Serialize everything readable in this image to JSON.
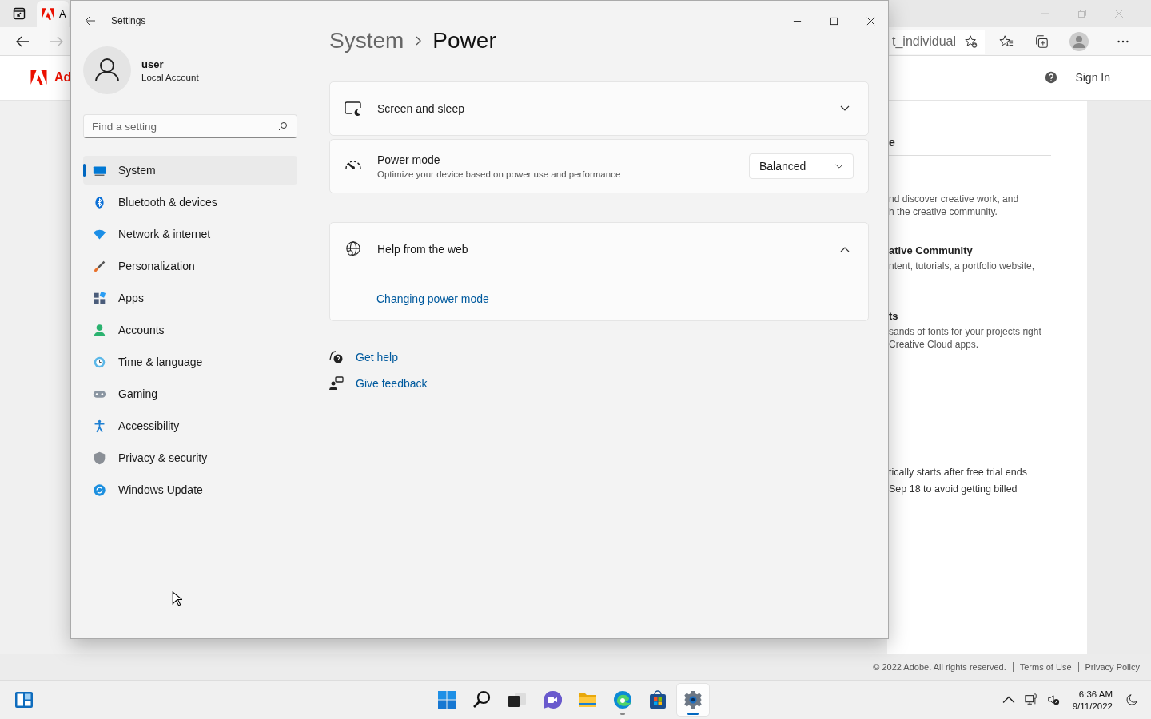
{
  "browser": {
    "tab": {
      "label": "A"
    },
    "address": "t_individual",
    "logo_text": "Ad",
    "sign_in": "Sign In",
    "content": {
      "heading": "e",
      "intro_lines": [
        "nd discover creative work, and",
        "h the creative community."
      ],
      "features": [
        {
          "title": "ative Community",
          "lines": [
            "ntent, tutorials, a portfolio website,"
          ]
        },
        {
          "title": "ts",
          "lines": [
            "sands of fonts for your projects right",
            "Creative Cloud apps."
          ]
        }
      ],
      "trial_lines": [
        "tically starts after free trial ends",
        "Sep 18 to avoid getting billed"
      ]
    },
    "footer": {
      "copyright": "© 2022 Adobe. All rights reserved.",
      "links": [
        "Terms of Use",
        "Privacy Policy"
      ]
    }
  },
  "settings": {
    "title": "Settings",
    "user": {
      "name": "user",
      "account": "Local Account"
    },
    "search": {
      "placeholder": "Find a setting"
    },
    "nav": [
      {
        "label": "System",
        "selected": true
      },
      {
        "label": "Bluetooth & devices",
        "selected": false
      },
      {
        "label": "Network & internet",
        "selected": false
      },
      {
        "label": "Personalization",
        "selected": false
      },
      {
        "label": "Apps",
        "selected": false
      },
      {
        "label": "Accounts",
        "selected": false
      },
      {
        "label": "Time & language",
        "selected": false
      },
      {
        "label": "Gaming",
        "selected": false
      },
      {
        "label": "Accessibility",
        "selected": false
      },
      {
        "label": "Privacy & security",
        "selected": false
      },
      {
        "label": "Windows Update",
        "selected": false
      }
    ],
    "breadcrumb": [
      "System",
      "Power"
    ],
    "cards": [
      {
        "kind": "expander",
        "title": "Screen and sleep",
        "expanded": false
      },
      {
        "kind": "select",
        "title": "Power mode",
        "description": "Optimize your device based on power use and performance",
        "value": "Balanced"
      },
      {
        "kind": "expander",
        "title": "Help from the web",
        "expanded": true,
        "links": [
          "Changing power mode"
        ]
      }
    ],
    "help_links": [
      "Get help",
      "Give feedback"
    ]
  },
  "taskbar": {
    "apps": [
      {
        "kind": "start",
        "open": false,
        "selected": false
      },
      {
        "kind": "search",
        "open": false,
        "selected": false
      },
      {
        "kind": "taskview",
        "open": false,
        "selected": false
      },
      {
        "kind": "chat",
        "open": false,
        "selected": false
      },
      {
        "kind": "explorer",
        "open": false,
        "selected": false
      },
      {
        "kind": "edge",
        "open": true,
        "selected": false
      },
      {
        "kind": "store",
        "open": false,
        "selected": false
      },
      {
        "kind": "settings",
        "open": true,
        "selected": true
      }
    ],
    "time": "6:36 AM",
    "date": "9/11/2022"
  }
}
